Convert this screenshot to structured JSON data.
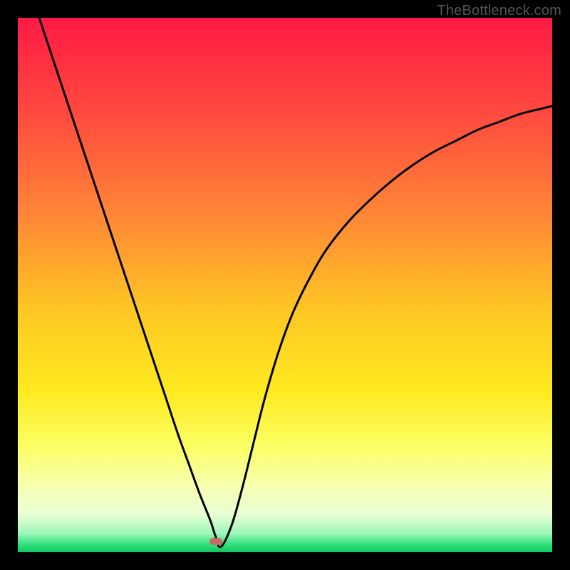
{
  "watermark": "TheBottleneck.com",
  "chart_data": {
    "type": "line",
    "title": "",
    "xlabel": "",
    "ylabel": "",
    "xlim": [
      0,
      100
    ],
    "ylim": [
      0,
      100
    ],
    "grid": false,
    "legend": false,
    "curve": {
      "name": "bottleneck-curve",
      "x": [
        4,
        6,
        8,
        10,
        12,
        14,
        16,
        18,
        20,
        22,
        24,
        26,
        28,
        30,
        32,
        34,
        36,
        37,
        38,
        40,
        42,
        44,
        46,
        48,
        50,
        52,
        55,
        58,
        62,
        66,
        70,
        74,
        78,
        82,
        86,
        90,
        94,
        98,
        100
      ],
      "y": [
        100,
        94,
        88,
        82,
        76,
        70,
        64,
        58,
        52,
        46,
        40,
        34,
        28,
        22,
        16.5,
        11,
        6,
        3,
        1,
        5,
        12,
        20,
        28,
        35,
        41,
        46,
        52,
        57,
        62,
        66,
        69.5,
        72.5,
        75,
        77,
        79,
        80.5,
        82,
        83,
        83.5
      ]
    },
    "marker": {
      "x": 37,
      "y": 2,
      "color": "#c96a64"
    },
    "gradient_stops": [
      {
        "pos": 0.0,
        "color": "#ff1a44"
      },
      {
        "pos": 0.18,
        "color": "#ff4a3f"
      },
      {
        "pos": 0.38,
        "color": "#ff8a35"
      },
      {
        "pos": 0.55,
        "color": "#ffc823"
      },
      {
        "pos": 0.7,
        "color": "#ffea20"
      },
      {
        "pos": 0.8,
        "color": "#fbff62"
      },
      {
        "pos": 0.88,
        "color": "#f7ffb4"
      },
      {
        "pos": 0.93,
        "color": "#e8ffd5"
      },
      {
        "pos": 0.965,
        "color": "#9cf7b8"
      },
      {
        "pos": 0.985,
        "color": "#35e07f"
      },
      {
        "pos": 1.0,
        "color": "#0cc95f"
      }
    ]
  }
}
